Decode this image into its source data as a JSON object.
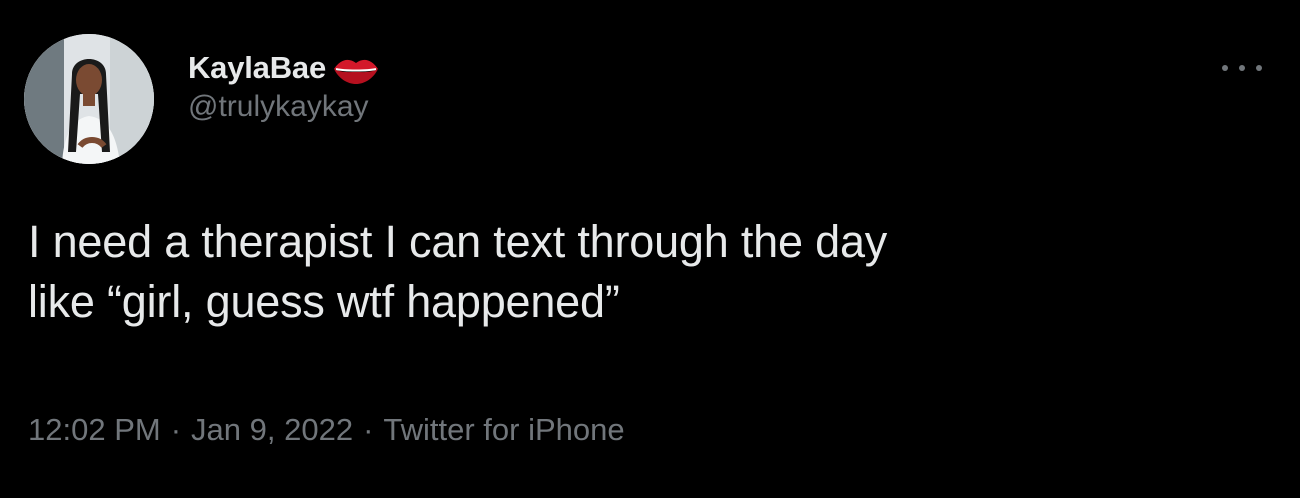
{
  "tweet": {
    "author": {
      "display_name": "KaylaBae",
      "name_emoji": "lips-icon",
      "handle": "@trulykaykay",
      "avatar": "profile-photo"
    },
    "text": "I need a therapist I can text through the day\nlike “girl, guess wtf happened”",
    "time": "12:02 PM",
    "date": "Jan 9, 2022",
    "source": "Twitter for iPhone",
    "separator": "·",
    "more_icon": "ellipsis-icon"
  },
  "colors": {
    "background": "#000000",
    "primary_text": "#e7e9ea",
    "secondary_text": "#71767b",
    "lips": "#d3182a"
  }
}
